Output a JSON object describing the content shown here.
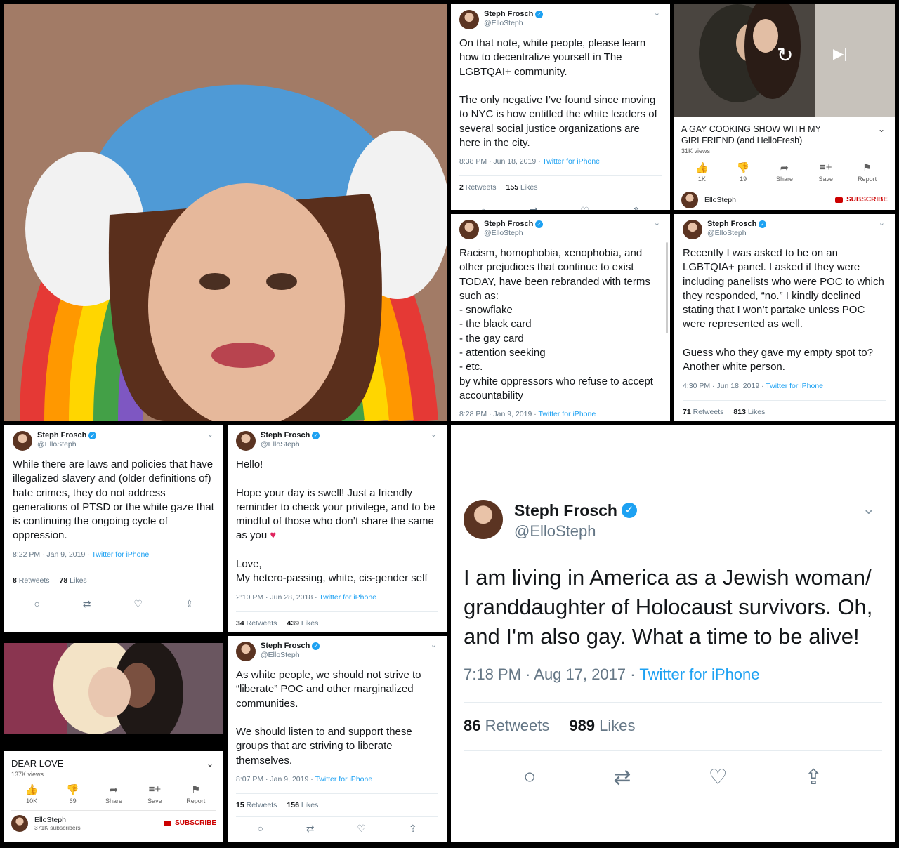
{
  "tweets": {
    "t1": {
      "name": "Steph Frosch",
      "handle": "@ElloSteph",
      "text": "On that note, white people, please learn how to decentralize yourself in The LGBTQAI+ community.\n\nThe only negative I’ve found since moving to NYC is how entitled the white leaders of several social justice organizations are here in the city.",
      "time": "8:38 PM · Jun 18, 2019 · ",
      "source": "Twitter for iPhone",
      "retweets": "2",
      "retweets_label": "Retweets",
      "likes": "155",
      "likes_label": "Likes"
    },
    "t2": {
      "name": "Steph Frosch",
      "handle": "@ElloSteph",
      "text": "Racism, homophobia, xenophobia, and other prejudices that continue to exist TODAY, have been rebranded with terms such as:\n- snowflake\n- the black card\n- the gay card\n- attention seeking\n- etc.\nby white oppressors who refuse to accept accountability",
      "time": "8:28 PM · Jan 9, 2019 · ",
      "source": "Twitter for iPhone"
    },
    "t3": {
      "name": "Steph Frosch",
      "handle": "@ElloSteph",
      "text": "Recently I was asked to be on an LGBTQIA+ panel. I asked if they were including panelists who were POC to which they responded, “no.” I kindly declined stating that I won’t partake unless POC were represented as well.\n\nGuess who they gave my empty spot to? Another white person.",
      "time": "4:30 PM · Jun 18, 2019 · ",
      "source": "Twitter for iPhone",
      "retweets": "71",
      "retweets_label": "Retweets",
      "likes": "813",
      "likes_label": "Likes"
    },
    "t4": {
      "name": "Steph Frosch",
      "handle": "@ElloSteph",
      "text": "While there are laws and policies that have illegalized slavery and (older definitions of) hate crimes, they do not address generations of PTSD or the white gaze that is continuing the ongoing cycle of oppression.",
      "time": "8:22 PM · Jan 9, 2019 · ",
      "source": "Twitter for iPhone",
      "retweets": "8",
      "retweets_label": "Retweets",
      "likes": "78",
      "likes_label": "Likes"
    },
    "t5": {
      "name": "Steph Frosch",
      "handle": "@ElloSteph",
      "text": "Hello!\n\nHope your day is swell! Just a friendly reminder to check your privilege, and to be mindful of those who don’t share the same as you",
      "text2": "\n\nLove,\nMy hetero-passing, white, cis-gender self",
      "time": "2:10 PM · Jun 28, 2018 · ",
      "source": "Twitter for iPhone",
      "retweets": "34",
      "retweets_label": "Retweets",
      "likes": "439",
      "likes_label": "Likes"
    },
    "t6": {
      "name": "Steph Frosch",
      "handle": "@ElloSteph",
      "text": "As white people, we should not strive to “liberate” POC and other marginalized communities.\n\nWe should listen to and support these groups that are striving to liberate themselves.",
      "time": "8:07 PM · Jan 9, 2019 · ",
      "source": "Twitter for iPhone",
      "retweets": "15",
      "retweets_label": "Retweets",
      "likes": "156",
      "likes_label": "Likes"
    },
    "t7": {
      "name": "Steph Frosch",
      "handle": "@ElloSteph",
      "text": "I am living in America as a Jewish woman/ granddaughter of Holocaust survivors. Oh, and I'm also gay. What a time to be alive!",
      "time": "7:18 PM · Aug 17, 2017 · ",
      "source": "Twitter for iPhone",
      "retweets": "86",
      "retweets_label": "Retweets",
      "likes": "989",
      "likes_label": "Likes"
    }
  },
  "videos": {
    "v1": {
      "title": "A GAY COOKING SHOW WITH MY GIRLFRIEND (and HelloFresh)",
      "views": "31K views",
      "likes": "1K",
      "dislikes": "19",
      "share": "Share",
      "save": "Save",
      "report": "Report",
      "channel": "ElloSteph",
      "subscribe": "SUBSCRIBE"
    },
    "v2": {
      "title": "DEAR LOVE",
      "views": "137K views",
      "likes": "10K",
      "dislikes": "69",
      "share": "Share",
      "save": "Save",
      "report": "Report",
      "channel": "ElloSteph",
      "subs": "371K subscribers",
      "subscribe": "SUBSCRIBE"
    }
  },
  "icons": {
    "verified": "verified-badge",
    "chevron": "chevron-down-icon",
    "reply": "reply-icon",
    "retweet": "retweet-icon",
    "like": "like-icon",
    "share": "share-icon",
    "heart": "red-heart-emoji"
  },
  "colors": {
    "twitter_blue": "#1da1f2",
    "youtube_red": "#cc0000",
    "heart": "#e0245e"
  }
}
